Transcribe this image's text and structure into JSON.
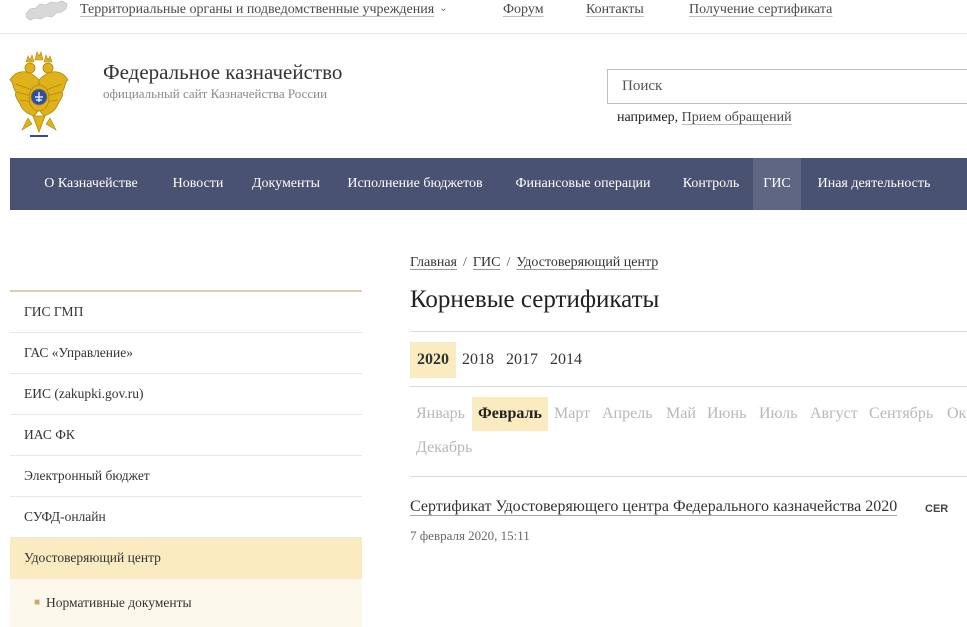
{
  "topbar": {
    "map_icon": "russia-map-icon",
    "territorial_label": "Территориальные органы и подведомственные учреждения",
    "forum_label": "Форум",
    "contacts_label": "Контакты",
    "certificate_label": "Получение сертификата"
  },
  "header": {
    "logo_icon": "double-headed-eagle-emblem",
    "title": "Федеральное казначейство",
    "subtitle": "официальный сайт Казначейства России"
  },
  "search": {
    "placeholder": "Поиск",
    "hint_prefix": "например,",
    "hint_link": "Прием обращений"
  },
  "mainnav": {
    "items": [
      {
        "label": "О Казначействе"
      },
      {
        "label": "Новости"
      },
      {
        "label": "Документы"
      },
      {
        "label": "Исполнение бюджетов"
      },
      {
        "label": "Финансовые операции"
      },
      {
        "label": "Контроль"
      },
      {
        "label": "ГИС"
      },
      {
        "label": "Иная деятельность"
      }
    ],
    "active": "ГИС"
  },
  "sidebar": {
    "items": [
      {
        "label": "ГИС ГМП"
      },
      {
        "label": "ГАС «Управление»"
      },
      {
        "label": "ЕИС (zakupki.gov.ru)"
      },
      {
        "label": "ИАС ФК"
      },
      {
        "label": "Электронный бюджет"
      },
      {
        "label": "СУФД-онлайн"
      },
      {
        "label": "Удостоверяющий центр"
      }
    ],
    "active": "Удостоверяющий центр",
    "subitems": [
      {
        "label": "Нормативные документы"
      }
    ]
  },
  "breadcrumb": {
    "home": "Главная",
    "gis": "ГИС",
    "current": "Удостоверяющий центр",
    "separator": "/"
  },
  "page": {
    "title": "Корневые сертификаты"
  },
  "years": {
    "items": [
      "2020",
      "2018",
      "2017",
      "2014"
    ],
    "active": "2020"
  },
  "months": {
    "items": [
      "Январь",
      "Февраль",
      "Март",
      "Апрель",
      "Май",
      "Июнь",
      "Июль",
      "Август",
      "Сентябрь",
      "Ок",
      "Декабрь"
    ],
    "active": "Февраль"
  },
  "document": {
    "title": "Сертификат Удостоверяющего центра Федерального казначейства 2020",
    "badge": "CER",
    "date": "7 февраля 2020, 15:11"
  },
  "colors": {
    "nav_bg": "#4a5271",
    "nav_active": "#5e6683",
    "highlight": "#faebc1",
    "sidebar_top_border": "#d9cfae"
  }
}
